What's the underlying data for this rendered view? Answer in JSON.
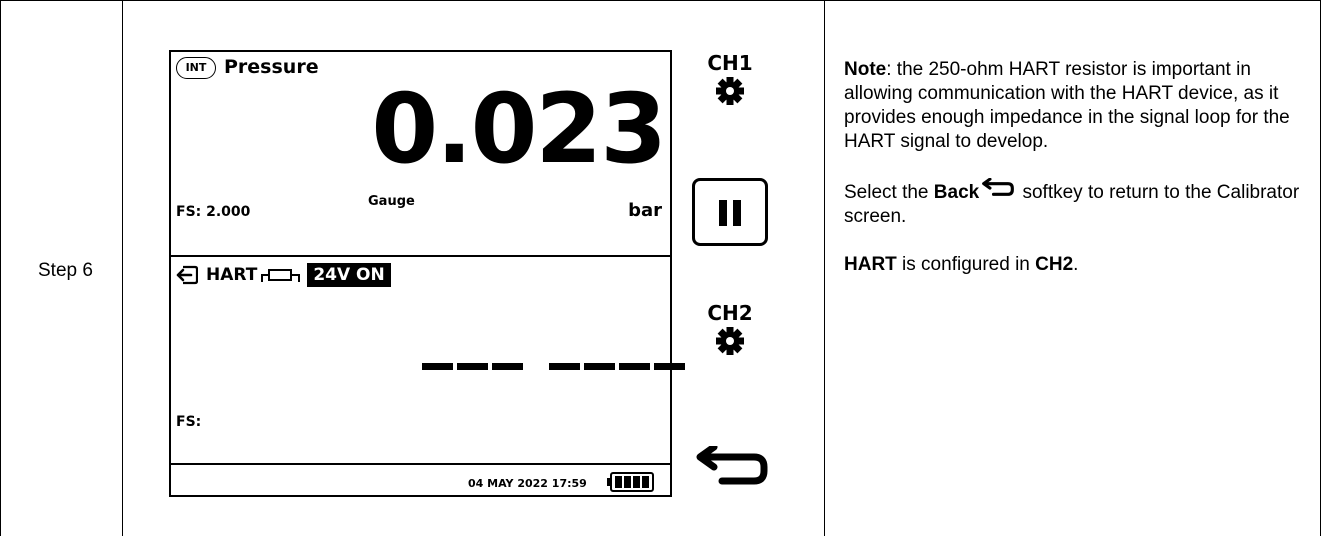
{
  "step": {
    "label": "Step 6"
  },
  "device": {
    "ch1": {
      "badge": "INT",
      "title": "Pressure",
      "value": "0.023",
      "fs": "FS: 2.000",
      "mode": "Gauge",
      "unit": "bar"
    },
    "ch2": {
      "title": "HART",
      "power": "24V ON",
      "fs": "FS:"
    },
    "status": {
      "datetime": "04 MAY 2022 17:59",
      "battery_level": 1.0
    }
  },
  "softkeys": {
    "ch1_label": "CH1",
    "ch2_label": "CH2",
    "icons": [
      "gear-icon",
      "pause-icon",
      "gear-icon",
      "back-arrow-icon"
    ]
  },
  "note": {
    "p1_bold": "Note",
    "p1_text": ": the 250-ohm HART resistor is important in allowing communication with the HART device, as it provides enough impedance in the signal loop for the HART signal to develop.",
    "p2_pre": "Select the ",
    "p2_bold": "Back",
    "p2_post": " softkey to return to the Calibrator screen.",
    "p3_bold1": "HART",
    "p3_mid": " is configured in ",
    "p3_bold2": "CH2",
    "p3_end": "."
  }
}
